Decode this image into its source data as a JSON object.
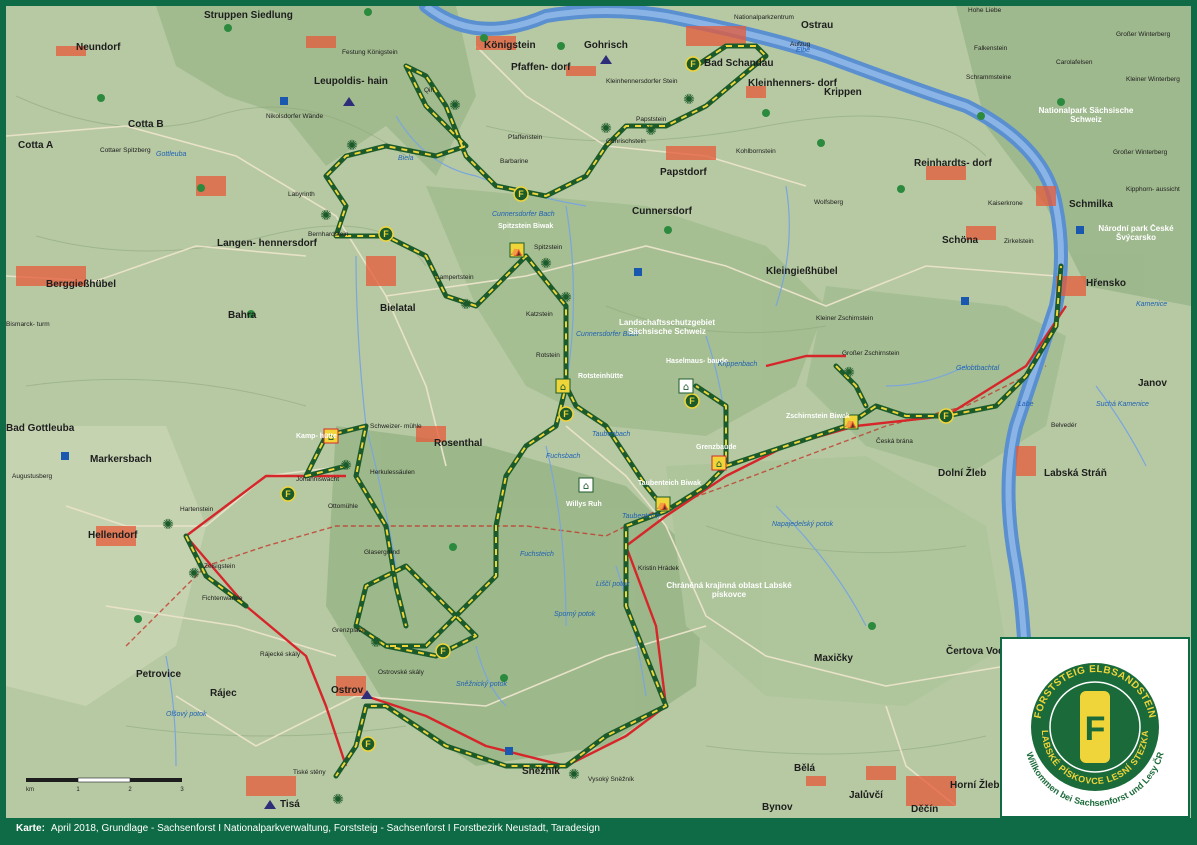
{
  "map": {
    "places_de": [
      {
        "name": "Neundorf"
      },
      {
        "name": "Struppen Siedlung"
      },
      {
        "name": "Königstein"
      },
      {
        "name": "Gohrisch"
      },
      {
        "name": "Bad Schandau"
      },
      {
        "name": "Ostrau"
      },
      {
        "name": "Pfaffen- dorf"
      },
      {
        "name": "Kleinhenners- dorf"
      },
      {
        "name": "Krippen"
      },
      {
        "name": "Leupoldis- hain"
      },
      {
        "name": "Cotta B"
      },
      {
        "name": "Cotta A"
      },
      {
        "name": "Papstdorf"
      },
      {
        "name": "Reinhardts- dorf"
      },
      {
        "name": "Cunnersdorf"
      },
      {
        "name": "Schmilka"
      },
      {
        "name": "Schöna"
      },
      {
        "name": "Langen- hennersdorf"
      },
      {
        "name": "Berggießhübel"
      },
      {
        "name": "Kleingießhübel"
      },
      {
        "name": "Hřensko"
      },
      {
        "name": "Bielatal"
      },
      {
        "name": "Bahra"
      },
      {
        "name": "Rosenthal"
      },
      {
        "name": "Markersbach"
      },
      {
        "name": "Bad Gottleuba"
      },
      {
        "name": "Hellendorf"
      },
      {
        "name": "Dolní Žleb"
      },
      {
        "name": "Janov"
      },
      {
        "name": "Labská Stráň"
      },
      {
        "name": "Petrovice"
      },
      {
        "name": "Rájec"
      },
      {
        "name": "Ostrov"
      },
      {
        "name": "Sněžník"
      },
      {
        "name": "Maxičky"
      },
      {
        "name": "Čertova Voda"
      },
      {
        "name": "Tisá"
      },
      {
        "name": "Bělá"
      },
      {
        "name": "Bynov"
      },
      {
        "name": "Jalůvčí"
      },
      {
        "name": "Děčín"
      },
      {
        "name": "Horní Žleb"
      }
    ],
    "small_labels": [
      "Festung Königstein",
      "Nationalparkzentrum",
      "Aufzug",
      "Nikolsdorfer Wände",
      "Cottaer Spitzberg",
      "Labyrinth",
      "Bernhardstein",
      "Qirl",
      "Papststein",
      "Gohrischstein",
      "Pfaffenstein",
      "Barbarine",
      "Kleinhennersdorfer Stein",
      "Kohlbornstein",
      "Wolfsberg",
      "Kaiserkrone",
      "Zirkelstein",
      "Lampertstein",
      "Spitzstein",
      "Katzstein",
      "Rotstein",
      "Kleiner Zschirnstein",
      "Großer Zschirnstein",
      "Schweizer- mühle",
      "Herkulessäulen",
      "Ottomühle",
      "Glasergrund",
      "Grenzplatte",
      "Hartenstein",
      "Zeisigstein",
      "Fichtenwände",
      "Rájecké skály",
      "Ostrovské skály",
      "Kristin Hrádek",
      "Česká brána",
      "Belvedér",
      "Tiské stěny",
      "Vysoký Sněžník",
      "Augustusberg",
      "Bismarck- turm",
      "Johanniswacht",
      "Hohe Liebe",
      "Falkenstein",
      "Schrammsteine",
      "Carolafelsen",
      "Großer Winterberg",
      "Kleiner Winterberg",
      "Großer Winterberg",
      "Kipphorn- aussicht"
    ],
    "huts": [
      {
        "name": "Spitzstein Biwak"
      },
      {
        "name": "Rotsteinhütte"
      },
      {
        "name": "Haselmaus- baude"
      },
      {
        "name": "Zschirnstein Biwak"
      },
      {
        "name": "Grenzbaude"
      },
      {
        "name": "Taubenteich Biwak"
      },
      {
        "name": "Willys Ruh"
      },
      {
        "name": "Kamp- hütte"
      }
    ],
    "water": [
      "Elbe",
      "Labe",
      "Biela",
      "Cunnersdorfer Bach",
      "Cunnersdorfer Bach",
      "Taubenbach",
      "Fuchsbach",
      "Fuchsteich",
      "Taubenteich",
      "Liščí potok",
      "Sporný potok",
      "Sněžnický potok",
      "Olšový potok",
      "Gelobtbachtal",
      "Krippenbach",
      "Napajedelský potok",
      "Suchá Kamenice",
      "Gottleuba",
      "Kamenice"
    ],
    "areas": [
      {
        "name": "Nationalpark Sächsische Schweiz"
      },
      {
        "name": "Národní park České Švýcarsko"
      },
      {
        "name": "Landschaftsschutzgebiet Sächsische Schweiz"
      },
      {
        "name": "Chráněná krajinná oblast Labské pískovce"
      }
    ],
    "scale": {
      "unit": "km",
      "ticks": [
        "0",
        "1",
        "2",
        "3"
      ]
    },
    "colors": {
      "trail_green": "#1b5a2a",
      "trail_yellow": "#f0d53a",
      "alt_route": "#d6262a",
      "river": "#5a8fd0",
      "settlement": "#e65a3a",
      "border": "#c0392b"
    }
  },
  "logo": {
    "ring_top": "FORSTSTEIG ELBSANDSTEIN",
    "ring_bottom": "LABSKÉ PÍSKOVCE LESNÍ STEZKA",
    "ring_outer": "Willkommen bei Sachsenforst und Lesy ČR",
    "letter": "F"
  },
  "footer": {
    "label": "Karte:",
    "text": "April 2018, Grundlage - Sachsenforst I Nationalparkverwaltung, Forststeig - Sachsenforst I Forstbezirk Neustadt, Taradesign"
  }
}
